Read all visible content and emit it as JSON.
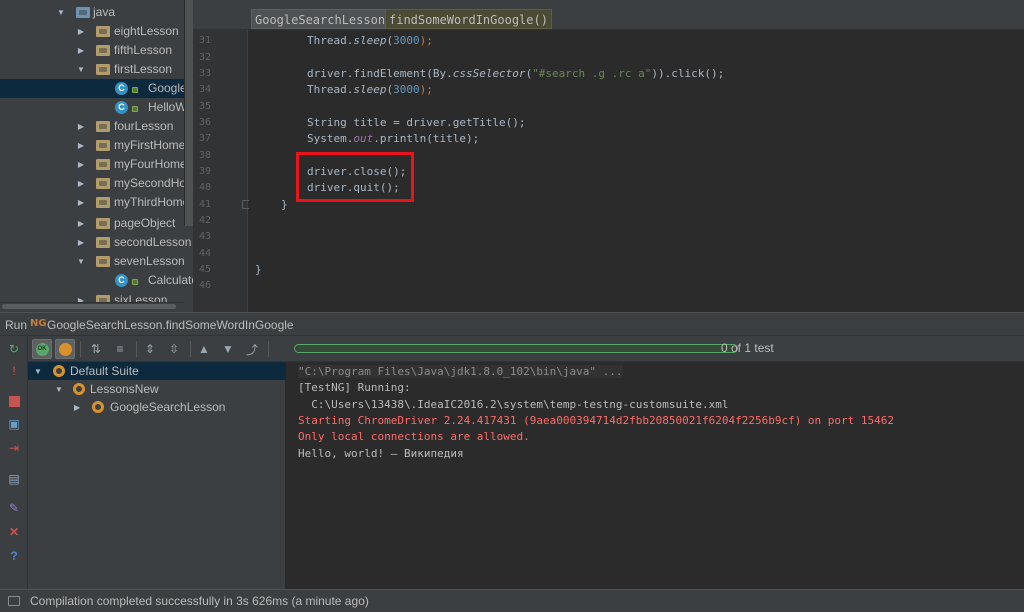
{
  "project_tree": {
    "items": [
      {
        "label": "java",
        "expanded": true,
        "icon": "source-folder-icon",
        "selected": false
      },
      {
        "label": "eightLesson",
        "expanded": false,
        "icon": "package-folder-icon",
        "selected": false
      },
      {
        "label": "fifthLesson",
        "expanded": false,
        "icon": "package-folder-icon",
        "selected": false
      },
      {
        "label": "firstLesson",
        "expanded": true,
        "icon": "package-folder-icon",
        "selected": false
      },
      {
        "label": "GoogleSe",
        "expanded": null,
        "icon": "java-class-icon",
        "selected": true
      },
      {
        "label": "HelloWo",
        "expanded": null,
        "icon": "java-class-icon",
        "selected": false
      },
      {
        "label": "fourLesson",
        "expanded": false,
        "icon": "package-folder-icon",
        "selected": false
      },
      {
        "label": "myFirstHomeTa",
        "expanded": false,
        "icon": "package-folder-icon",
        "selected": false
      },
      {
        "label": "myFourHomeTa",
        "expanded": false,
        "icon": "package-folder-icon",
        "selected": false
      },
      {
        "label": "mySecondHom",
        "expanded": false,
        "icon": "package-folder-icon",
        "selected": false
      },
      {
        "label": "myThirdHomeT",
        "expanded": false,
        "icon": "package-folder-icon",
        "selected": false
      },
      {
        "label": "pageObject",
        "expanded": false,
        "icon": "package-folder-icon",
        "selected": false
      },
      {
        "label": "secondLesson",
        "expanded": false,
        "icon": "package-folder-icon",
        "selected": false
      },
      {
        "label": "sevenLesson",
        "expanded": true,
        "icon": "package-folder-icon",
        "selected": false
      },
      {
        "label": "Calculato",
        "expanded": null,
        "icon": "java-class-icon",
        "selected": false
      },
      {
        "label": "sixLesson",
        "expanded": false,
        "icon": "package-folder-icon",
        "selected": false
      }
    ]
  },
  "editor": {
    "breadcrumb_class": "GoogleSearchLesson",
    "breadcrumb_method": "findSomeWordInGoogle()",
    "line_numbers": [
      "31",
      "32",
      "33",
      "34",
      "35",
      "36",
      "37",
      "38",
      "39",
      "40",
      "41",
      "42",
      "43",
      "44",
      "45",
      "46"
    ],
    "code": {
      "l31": {
        "a": "Thread.",
        "b": "sleep",
        "c": "(",
        "d": "3000",
        "e": ");"
      },
      "l33": {
        "a": "driver.findElement(By.",
        "b": "cssSelector",
        "c": "(",
        "d": "\"#search .g .rc a\"",
        "e": ")).click();"
      },
      "l34": {
        "a": "Thread.",
        "b": "sleep",
        "c": "(",
        "d": "3000",
        "e": ");"
      },
      "l36": {
        "a": "String title = driver.getTitle();"
      },
      "l37": {
        "a": "System.",
        "b": "out",
        "c": ".println(title);"
      },
      "l39": {
        "a": "driver.close();"
      },
      "l40": {
        "a": "driver.quit();"
      },
      "l41": {
        "a": "}"
      },
      "l45": {
        "a": "}"
      }
    },
    "highlight_color": "#e8141b"
  },
  "run_panel": {
    "label": "Run",
    "testng_icon": "NG",
    "config_name": "GoogleSearchLesson.findSomeWordInGoogle",
    "test_count": "0 of 1 test",
    "progress_fraction": 1.0,
    "progress_color": "#59a869",
    "suite_tree": [
      {
        "label": "Default Suite",
        "level": 0,
        "selected": true
      },
      {
        "label": "LessonsNew",
        "level": 1,
        "selected": false
      },
      {
        "label": "GoogleSearchLesson",
        "level": 2,
        "selected": false
      }
    ],
    "console": [
      {
        "text": "\"C:\\Program Files\\Java\\jdk1.8.0_102\\bin\\java\" ...",
        "style": "gray"
      },
      {
        "text": "[TestNG] Running:",
        "style": "normal"
      },
      {
        "text": "  C:\\Users\\13438\\.IdeaIC2016.2\\system\\temp-testng-customsuite.xml",
        "style": "normal"
      },
      {
        "text": "Starting ChromeDriver 2.24.417431 (9aea000394714d2fbb20850021f6204f2256b9cf) on port 15462",
        "style": "err"
      },
      {
        "text": "Only local connections are allowed.",
        "style": "err"
      },
      {
        "text": "Hello, world! — Википедия",
        "style": "normal"
      }
    ]
  },
  "status_bar": {
    "text": "Compilation completed successfully in 3s 626ms (a minute ago)"
  }
}
